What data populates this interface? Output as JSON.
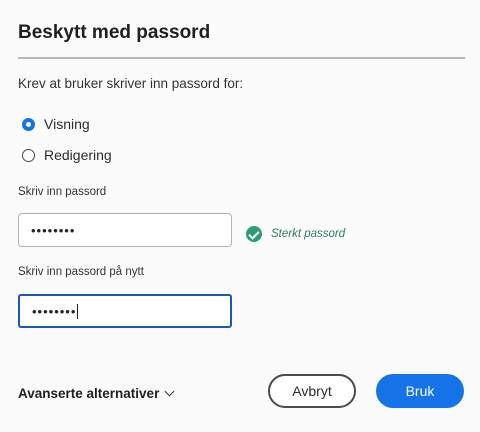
{
  "dialog": {
    "title": "Beskytt med passord",
    "prompt": "Krev at bruker skriver inn passord for:",
    "options": [
      {
        "label": "Visning",
        "checked": true
      },
      {
        "label": "Redigering",
        "checked": false
      }
    ],
    "password_label": "Skriv inn passord",
    "password_value": "••••••••",
    "strength_text": "Sterkt passord",
    "confirm_label": "Skriv inn passord på nytt",
    "confirm_value": "••••••••",
    "advanced_label": "Avanserte alternativer",
    "cancel_label": "Avbryt",
    "apply_label": "Bruk",
    "colors": {
      "accent": "#1473e6",
      "success": "#2d9d78",
      "focus": "#1a57b8"
    },
    "icons": {
      "strength": "checkmark-circle-icon",
      "advanced": "chevron-down-icon"
    }
  }
}
